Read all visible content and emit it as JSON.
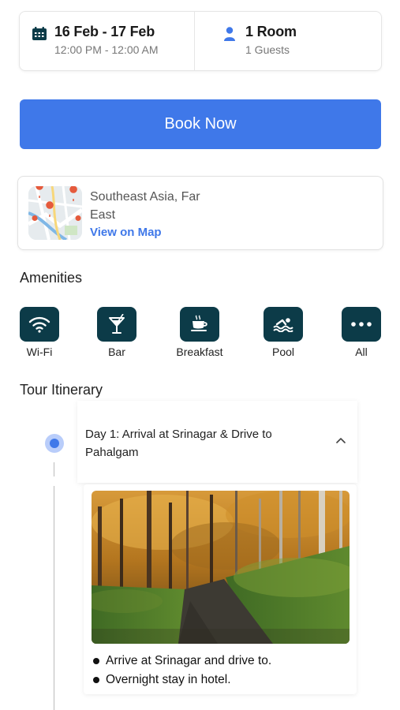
{
  "booking": {
    "dates": "16 Feb - 17 Feb",
    "times": "12:00 PM - 12:00 AM",
    "rooms": "1 Room",
    "guests": "1 Guests"
  },
  "cta": {
    "book_label": "Book Now"
  },
  "location": {
    "name": "Southeast Asia, Far East",
    "map_link": "View on Map"
  },
  "amenities": {
    "title": "Amenities",
    "items": [
      {
        "icon": "wifi-icon",
        "label": "Wi-Fi"
      },
      {
        "icon": "cocktail-icon",
        "label": "Bar"
      },
      {
        "icon": "coffee-icon",
        "label": "Breakfast"
      },
      {
        "icon": "swim-icon",
        "label": "Pool"
      },
      {
        "icon": "more-icon",
        "label": "All"
      }
    ]
  },
  "itinerary": {
    "title": "Tour Itinerary",
    "days": [
      {
        "title": "Day 1: Arrival at Srinagar & Drive to Pahalgam",
        "bullets": [
          "Arrive at Srinagar and drive to.",
          "Overnight stay in hotel."
        ]
      }
    ]
  },
  "colors": {
    "accent": "#3f78e9",
    "icon_bg": "#0c3b48",
    "dot_halo": "#b9cdfa"
  }
}
